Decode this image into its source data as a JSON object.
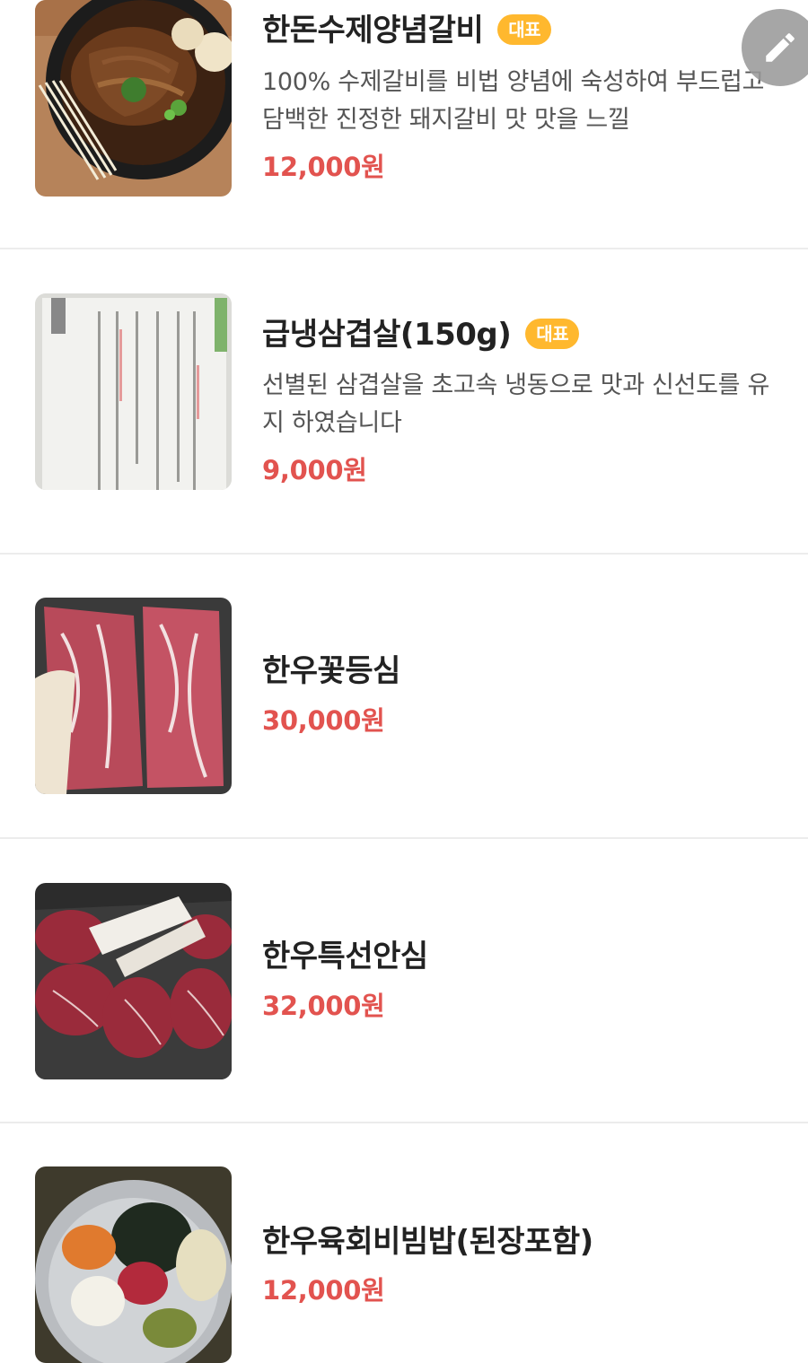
{
  "theme": {
    "price_color": "#e2534f",
    "badge_color": "#ffb82e",
    "fab_color": "#9a9a9a"
  },
  "fab": {
    "icon": "pencil-icon"
  },
  "menu": {
    "items": [
      {
        "name": "한돈수제양념갈비",
        "badge": "대표",
        "description": "100% 수제갈비를 비법 양념에 숙성하여 부드럽고 담백한 진정한 돼지갈비 맛 맛을 느낄",
        "price": "12,000원",
        "image": "marinated-pork-galbi-photo"
      },
      {
        "name": "급냉삼겹살(150g)",
        "badge": "대표",
        "description": "선별된 삼겹살을 초고속 냉동으로 맛과 신선도를 유지 하였습니다",
        "price": "9,000원",
        "image": "printed-menu-photo"
      },
      {
        "name": "한우꽃등심",
        "price": "30,000원",
        "image": "hanwoo-sirloin-photo"
      },
      {
        "name": "한우특선안심",
        "price": "32,000원",
        "image": "hanwoo-tenderloin-photo"
      },
      {
        "name": "한우육회비빔밥(된장포함)",
        "price": "12,000원",
        "image": "yukhoe-bibimbap-photo"
      }
    ]
  }
}
